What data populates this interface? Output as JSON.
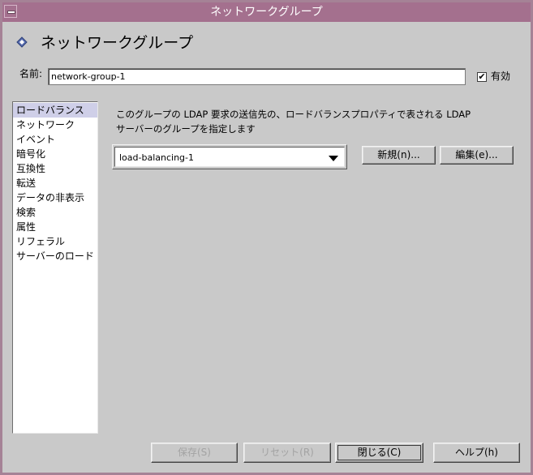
{
  "window": {
    "title": "ネットワークグループ"
  },
  "header": {
    "title": "ネットワークグループ",
    "icon": "diamond-icon"
  },
  "name_field": {
    "label": "名前:",
    "value": "network-group-1"
  },
  "enabled": {
    "label": "有効",
    "checked": true,
    "mark": "✔"
  },
  "sidebar": {
    "items": [
      {
        "label": "ロードバランス",
        "selected": true
      },
      {
        "label": "ネットワーク"
      },
      {
        "label": "イベント"
      },
      {
        "label": "暗号化"
      },
      {
        "label": "互換性"
      },
      {
        "label": "転送"
      },
      {
        "label": "データの非表示"
      },
      {
        "label": "検索"
      },
      {
        "label": "属性"
      },
      {
        "label": "リフェラル"
      },
      {
        "label": "サーバーのロード"
      }
    ]
  },
  "main": {
    "description_line1": "このグループの LDAP 要求の送信先の、ロードバランスプロパティで表される LDAP",
    "description_line2": "サーバーのグループを指定します",
    "select_value": "load-balancing-1",
    "new_button": "新規(n)...",
    "edit_button": "編集(e)..."
  },
  "footer": {
    "save": "保存(S)",
    "reset": "リセット(R)",
    "close": "閉じる(C)",
    "help": "ヘルプ(h)"
  }
}
